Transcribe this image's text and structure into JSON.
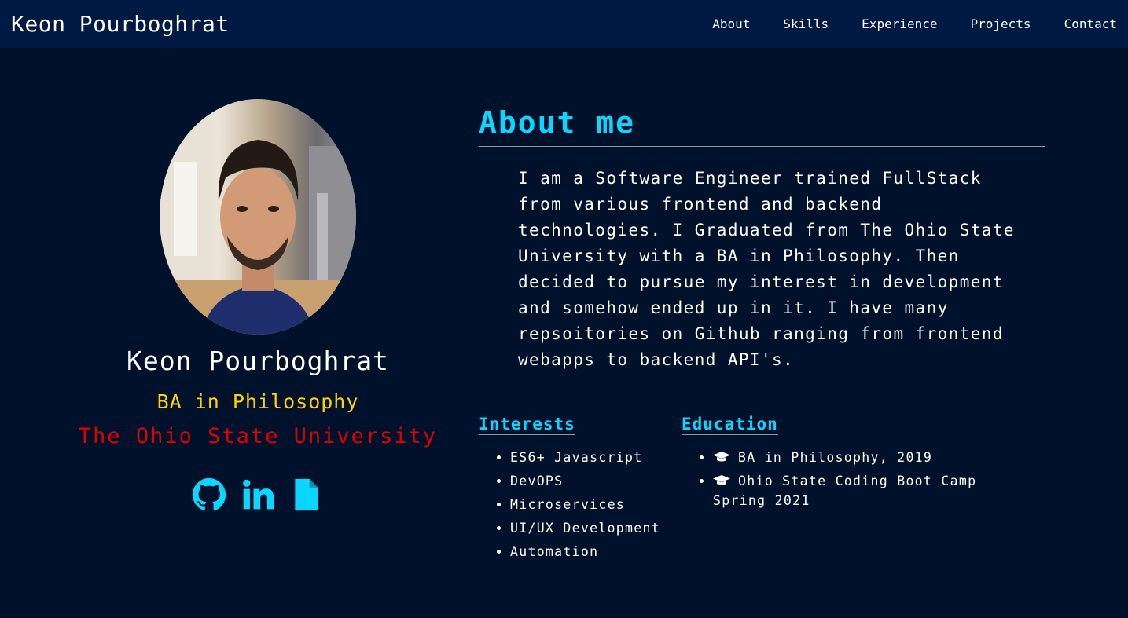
{
  "nav": {
    "brand": "Keon Pourboghrat",
    "links": [
      "About",
      "Skills",
      "Experience",
      "Projects",
      "Contact"
    ]
  },
  "profile": {
    "name": "Keon Pourboghrat",
    "degree": "BA in Philosophy",
    "school": "The Ohio State University",
    "social_icons": [
      "github-icon",
      "linkedin-icon",
      "file-icon"
    ]
  },
  "about": {
    "title": "About me",
    "text": "I am a Software Engineer trained FullStack from various frontend and backend technologies. I Graduated from The Ohio State University with a BA in Philosophy. Then decided to pursue my interest in development and somehow ended up in it. I have many repsoitories on Github ranging from frontend webapps to backend API's."
  },
  "interests": {
    "title": "Interests",
    "items": [
      "ES6+ Javascript",
      "DevOPS",
      "Microservices",
      "UI/UX Development",
      "Automation"
    ]
  },
  "education": {
    "title": "Education",
    "items": [
      "BA in Philosophy, 2019",
      "Ohio State Coding Boot Camp Spring 2021"
    ],
    "icon": "graduation-cap-icon"
  },
  "colors": {
    "background": "#00112b",
    "navbar": "#001a44",
    "accent": "#0ad7ff",
    "degree": "#ffd400",
    "school": "#e00000"
  }
}
